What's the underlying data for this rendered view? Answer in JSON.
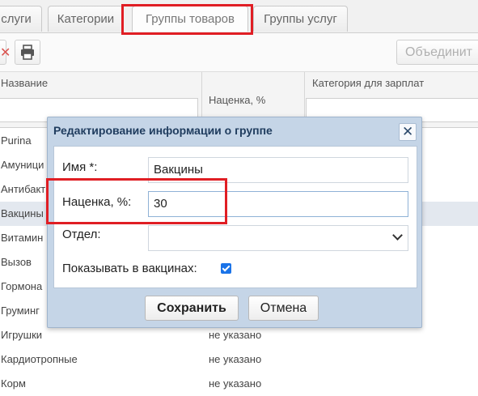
{
  "tabs": [
    {
      "label": "слуги"
    },
    {
      "label": "Категории"
    },
    {
      "label": "Группы товаров"
    },
    {
      "label": "Группы услуг"
    }
  ],
  "toolbar": {
    "delete_icon": "x-icon",
    "print_icon": "printer-icon",
    "merge_label": "Объединит"
  },
  "grid": {
    "columns": {
      "name": "Название",
      "markup": "Наценка, %",
      "salary_category": "Категория для зарплат"
    },
    "rows": [
      {
        "name": "Purina",
        "value": ""
      },
      {
        "name": "Амуници",
        "value": ""
      },
      {
        "name": "Антибакт",
        "value": ""
      },
      {
        "name": "Вакцины",
        "value": ""
      },
      {
        "name": "Витамин",
        "value": ""
      },
      {
        "name": "Вызов",
        "value": ""
      },
      {
        "name": "Гормона",
        "value": ""
      },
      {
        "name": "Груминг",
        "value": ""
      },
      {
        "name": "Игрушки",
        "value": "не указано"
      },
      {
        "name": "Кардиотропные",
        "value": "не указано"
      },
      {
        "name": "Корм",
        "value": "не указано"
      }
    ]
  },
  "dialog": {
    "title": "Редактирование информации о группе",
    "close_icon": "close-icon",
    "name_label": "Имя *:",
    "name_value": "Вакцины",
    "markup_label": "Наценка, %:",
    "markup_value": "30",
    "dept_label": "Отдел:",
    "dept_value": "",
    "show_in_vaccines_label": "Показывать в вакцинах:",
    "show_in_vaccines_checked": true,
    "save_label": "Сохранить",
    "cancel_label": "Отмена"
  },
  "colors": {
    "highlight": "#e01e24",
    "dialog_header": "#c5d5e7",
    "checkbox": "#1a73e8"
  }
}
